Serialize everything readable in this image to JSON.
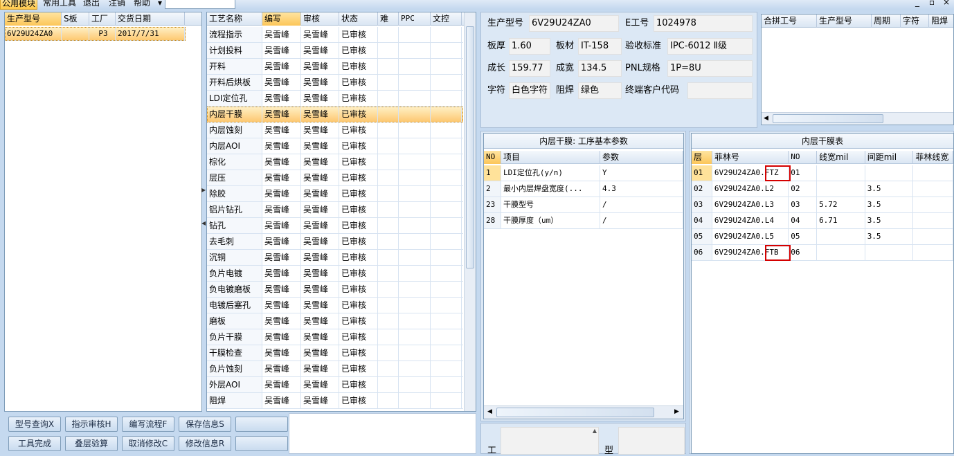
{
  "menubar": {
    "items": [
      "公用模块",
      "常用工具",
      "退出",
      "注销",
      "帮助"
    ],
    "window_controls": [
      "_",
      "▫",
      "×"
    ]
  },
  "orders": {
    "columns": [
      "生产型号",
      "S板",
      "工厂",
      "交货日期"
    ],
    "rows": [
      {
        "model": "6V29U24ZA0",
        "s": "",
        "factory": "P3",
        "date": "2017/7/31"
      }
    ]
  },
  "process": {
    "columns": [
      "工艺名称",
      "编写",
      "审核",
      "状态",
      "难",
      "PPC",
      "文控"
    ],
    "rows": [
      {
        "name": "流程指示",
        "writer": "吴雪峰",
        "reviewer": "吴雪峰",
        "status": "已审核"
      },
      {
        "name": "计划投料",
        "writer": "吴雪峰",
        "reviewer": "吴雪峰",
        "status": "已审核"
      },
      {
        "name": "开料",
        "writer": "吴雪峰",
        "reviewer": "吴雪峰",
        "status": "已审核"
      },
      {
        "name": "开料后烘板",
        "writer": "吴雪峰",
        "reviewer": "吴雪峰",
        "status": "已审核"
      },
      {
        "name": "LDI定位孔",
        "writer": "吴雪峰",
        "reviewer": "吴雪峰",
        "status": "已审核"
      },
      {
        "name": "内层干膜",
        "writer": "吴雪峰",
        "reviewer": "吴雪峰",
        "status": "已审核"
      },
      {
        "name": "内层蚀刻",
        "writer": "吴雪峰",
        "reviewer": "吴雪峰",
        "status": "已审核"
      },
      {
        "name": "内层AOI",
        "writer": "吴雪峰",
        "reviewer": "吴雪峰",
        "status": "已审核"
      },
      {
        "name": "棕化",
        "writer": "吴雪峰",
        "reviewer": "吴雪峰",
        "status": "已审核"
      },
      {
        "name": "层压",
        "writer": "吴雪峰",
        "reviewer": "吴雪峰",
        "status": "已审核"
      },
      {
        "name": "除胶",
        "writer": "吴雪峰",
        "reviewer": "吴雪峰",
        "status": "已审核"
      },
      {
        "name": "铝片钻孔",
        "writer": "吴雪峰",
        "reviewer": "吴雪峰",
        "status": "已审核"
      },
      {
        "name": "钻孔",
        "writer": "吴雪峰",
        "reviewer": "吴雪峰",
        "status": "已审核"
      },
      {
        "name": "去毛刺",
        "writer": "吴雪峰",
        "reviewer": "吴雪峰",
        "status": "已审核"
      },
      {
        "name": "沉铜",
        "writer": "吴雪峰",
        "reviewer": "吴雪峰",
        "status": "已审核"
      },
      {
        "name": "负片电镀",
        "writer": "吴雪峰",
        "reviewer": "吴雪峰",
        "status": "已审核"
      },
      {
        "name": "负电镀磨板",
        "writer": "吴雪峰",
        "reviewer": "吴雪峰",
        "status": "已审核"
      },
      {
        "name": "电镀后塞孔",
        "writer": "吴雪峰",
        "reviewer": "吴雪峰",
        "status": "已审核"
      },
      {
        "name": "磨板",
        "writer": "吴雪峰",
        "reviewer": "吴雪峰",
        "status": "已审核"
      },
      {
        "name": "负片干膜",
        "writer": "吴雪峰",
        "reviewer": "吴雪峰",
        "status": "已审核"
      },
      {
        "name": "干膜检查",
        "writer": "吴雪峰",
        "reviewer": "吴雪峰",
        "status": "已审核"
      },
      {
        "name": "负片蚀刻",
        "writer": "吴雪峰",
        "reviewer": "吴雪峰",
        "status": "已审核"
      },
      {
        "name": "外层AOI",
        "writer": "吴雪峰",
        "reviewer": "吴雪峰",
        "status": "已审核"
      },
      {
        "name": "阻焊",
        "writer": "吴雪峰",
        "reviewer": "吴雪峰",
        "status": "已审核"
      }
    ],
    "selected_index": 5
  },
  "info": {
    "model_label": "生产型号",
    "model_value": "6V29U24ZA0",
    "e_label": "E工号",
    "e_value": "1024978",
    "thick_label": "板厚",
    "thick_value": "1.60",
    "mat_label": "板材",
    "mat_value": "IT-158",
    "std_label": "验收标准",
    "std_value": "IPC-6012 Ⅱ级",
    "len_label": "成长",
    "len_value": "159.77",
    "wid_label": "成宽",
    "wid_value": "134.5",
    "pnl_label": "PNL规格",
    "pnl_value": "1P=8U",
    "char_label": "字符",
    "char_value": "白色字符",
    "mask_label": "阻焊",
    "mask_value": "绿色",
    "cust_label": "终端客户代码",
    "cust_value": ""
  },
  "merge": {
    "columns": [
      "合拼工号",
      "生产型号",
      "周期",
      "字符",
      "阻焊"
    ]
  },
  "params": {
    "title": "内层干膜: 工序基本参数",
    "columns": [
      "NO",
      "项目",
      "参数"
    ],
    "rows": [
      {
        "no": "1",
        "item": "LDI定位孔(y/n)",
        "value": "Y"
      },
      {
        "no": "2",
        "item": "最小内层焊盘宽度(...",
        "value": "4.3"
      },
      {
        "no": "23",
        "item": "干膜型号",
        "value": "/"
      },
      {
        "no": "28",
        "item": "干膜厚度（um）",
        "value": "/"
      }
    ]
  },
  "film": {
    "title": "内层干膜表",
    "columns": [
      "层",
      "菲林号",
      "NO",
      "线宽mil",
      "间距mil",
      "菲林线宽"
    ],
    "rows": [
      {
        "layer": "01",
        "film": "6V29U24ZA0.FTZ",
        "no": "01",
        "lw": "",
        "sp": "",
        "flw": ""
      },
      {
        "layer": "02",
        "film": "6V29U24ZA0.L2",
        "no": "02",
        "lw": "",
        "sp": "3.5",
        "flw": ""
      },
      {
        "layer": "03",
        "film": "6V29U24ZA0.L3",
        "no": "03",
        "lw": "5.72",
        "sp": "3.5",
        "flw": ""
      },
      {
        "layer": "04",
        "film": "6V29U24ZA0.L4",
        "no": "04",
        "lw": "6.71",
        "sp": "3.5",
        "flw": ""
      },
      {
        "layer": "05",
        "film": "6V29U24ZA0.L5",
        "no": "05",
        "lw": "",
        "sp": "3.5",
        "flw": ""
      },
      {
        "layer": "06",
        "film": "6V29U24ZA0.FTB",
        "no": "06",
        "lw": "",
        "sp": "",
        "flw": ""
      }
    ]
  },
  "buttons": {
    "row1": [
      "型号查询X",
      "指示审核H",
      "编写流程F",
      "保存信息S",
      ""
    ],
    "row2": [
      "工具完成",
      "叠层验算",
      "取消修改C",
      "修改信息R",
      ""
    ]
  },
  "bottom_labels": {
    "left": "工",
    "right": "型"
  }
}
